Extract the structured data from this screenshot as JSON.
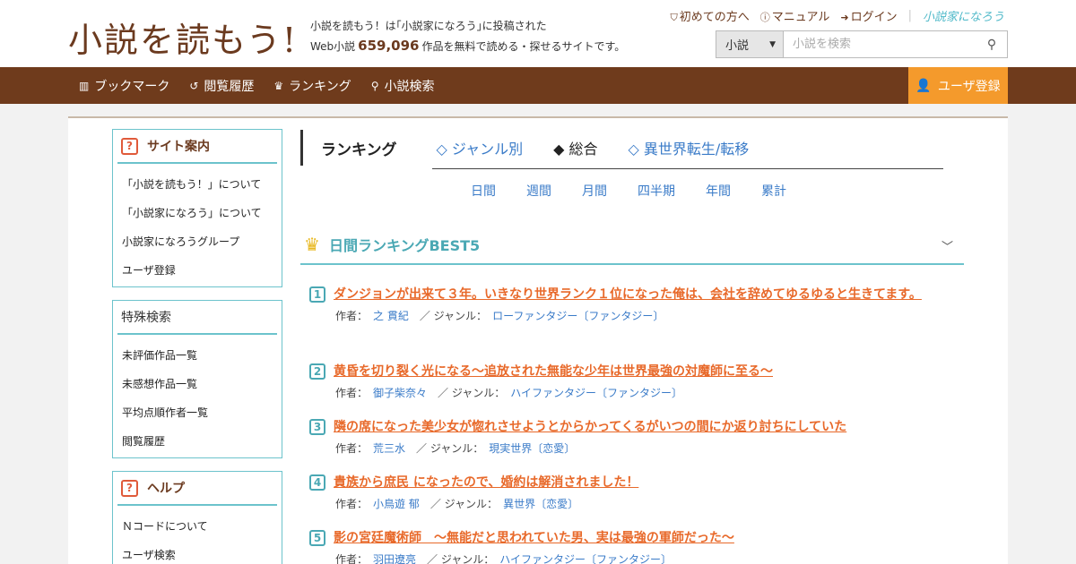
{
  "header": {
    "logo_text": "小説を読もう!",
    "tagline_line1": "小説を読もう！は｢小説家になろう｣に投稿された",
    "tagline_prefix": "Web小説",
    "tagline_count": "659,096",
    "tagline_suffix": "作品を無料で読める・探せるサイトです。",
    "links": [
      {
        "label": "初めての方へ",
        "icon": "shield-icon"
      },
      {
        "label": "マニュアル",
        "icon": "question-circle-icon"
      },
      {
        "label": "ログイン",
        "icon": "login-icon"
      }
    ],
    "partner_logo": "小説家になろう",
    "search": {
      "select_value": "小説",
      "placeholder": "小説を検索"
    }
  },
  "nav": {
    "items": [
      {
        "label": "ブックマーク",
        "icon": "bookmark-icon"
      },
      {
        "label": "閲覧履歴",
        "icon": "history-icon"
      },
      {
        "label": "ランキング",
        "icon": "crown-icon"
      },
      {
        "label": "小説検索",
        "icon": "search-icon"
      }
    ],
    "register_label": "ユーザ登録"
  },
  "sidebar": {
    "sections": [
      {
        "title": "サイト案内",
        "items": [
          "「小説を読もう！」について",
          "「小説家になろう」について",
          "小説家になろうグループ",
          "ユーザ登録"
        ]
      },
      {
        "title": "特殊検索",
        "items": [
          "未評価作品一覧",
          "未感想作品一覧",
          "平均点順作者一覧",
          "閲覧履歴"
        ]
      },
      {
        "title": "ヘルプ",
        "items": [
          "Ｎコードについて",
          "ユーザ検索"
        ]
      }
    ]
  },
  "ranking": {
    "title": "ランキング",
    "genre_tabs": [
      "◇ ジャンル別",
      "◆ 総合",
      "◇ 異世界転生/転移"
    ],
    "period_tabs": [
      "日間",
      "週間",
      "月間",
      "四半期",
      "年間",
      "累計"
    ],
    "best_title": "日間ランキングBEST5",
    "author_label": "作者：",
    "genre_label": "／ ジャンル：",
    "items": [
      {
        "rank": "1",
        "title": "ダンジョンが出来て３年。いきなり世界ランク１位になった俺は、会社を辞めてゆるゆると生きてます。",
        "author": "之 貫紀",
        "genre": "ローファンタジー〔ファンタジー〕"
      },
      {
        "rank": "2",
        "title": "黄昏を切り裂く光になる〜追放された無能な少年は世界最強の対魔師に至る〜",
        "author": "御子柴奈々",
        "genre": "ハイファンタジー〔ファンタジー〕"
      },
      {
        "rank": "3",
        "title": "隣の席になった美少女が惚れさせようとからかってくるがいつの間にか返り討ちにしていた",
        "author": "荒三水",
        "genre": "現実世界〔恋愛〕"
      },
      {
        "rank": "4",
        "title": "貴族から庶民 になったので、婚約は解消されました！",
        "author": "小鳥遊 郁",
        "genre": "異世界〔恋愛〕"
      },
      {
        "rank": "5",
        "title": "影の宮廷魔術師　～無能だと思われていた男、実は最強の軍師だった～",
        "author": "羽田遼亮",
        "genre": "ハイファンタジー〔ファンタジー〕"
      }
    ]
  }
}
